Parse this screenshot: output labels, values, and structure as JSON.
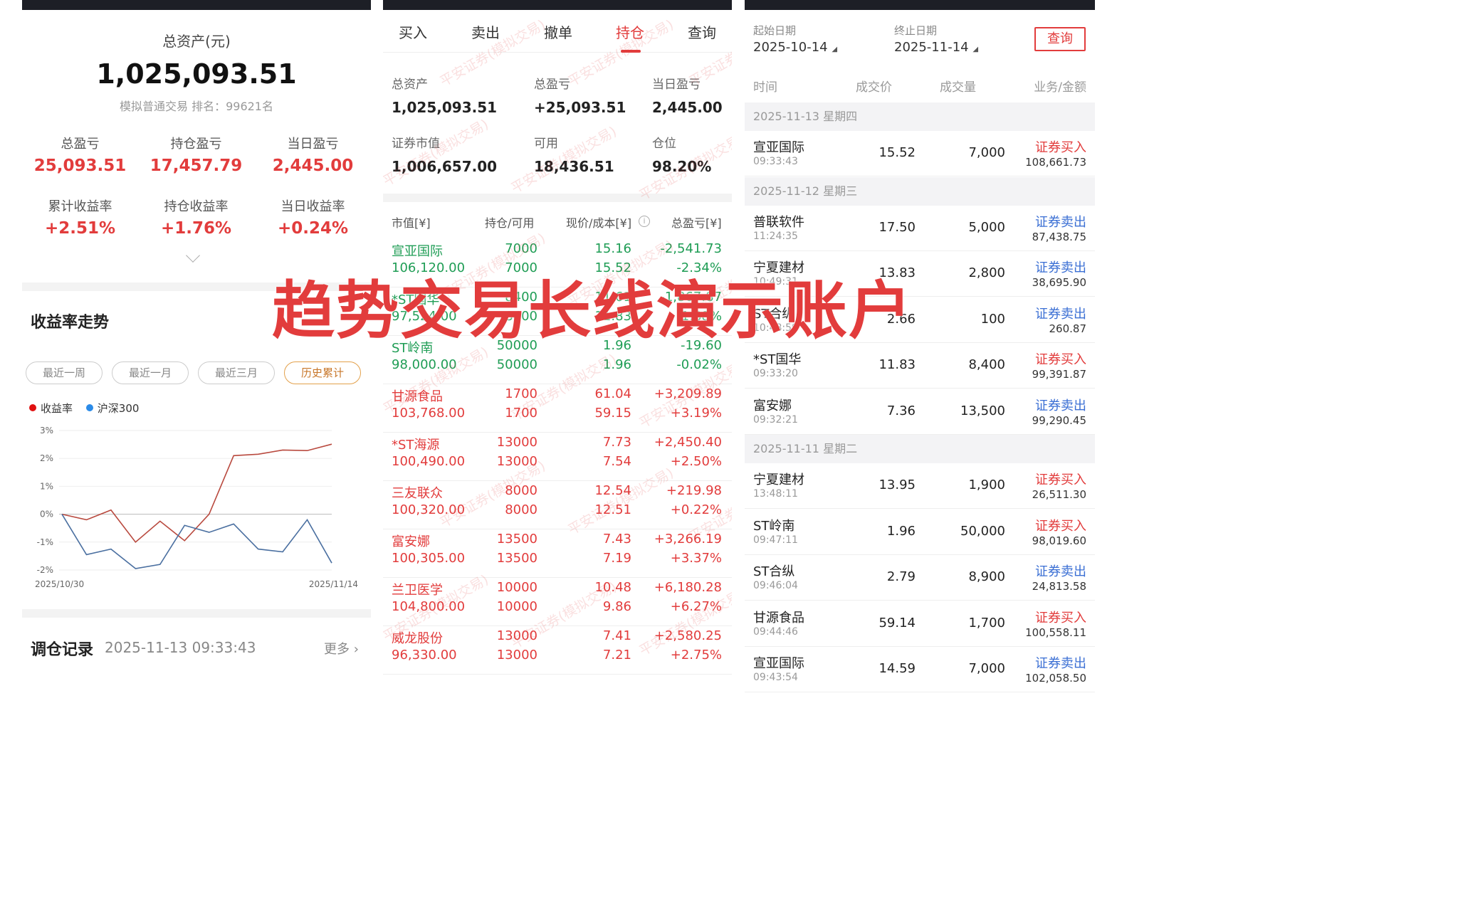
{
  "overview": {
    "total_assets_label": "总资产(元)",
    "total_assets_value": "1,025,093.51",
    "sub_label": "模拟普通交易 排名：99621名",
    "stats": [
      {
        "label": "总盈亏",
        "value": "25,093.51"
      },
      {
        "label": "持仓盈亏",
        "value": "17,457.79"
      },
      {
        "label": "当日盈亏",
        "value": "2,445.00"
      },
      {
        "label": "累计收益率",
        "value": "+2.51%"
      },
      {
        "label": "持仓收益率",
        "value": "+1.76%"
      },
      {
        "label": "当日收益率",
        "value": "+0.24%"
      }
    ],
    "trend_title": "收益率走势",
    "ranges": [
      "最近一周",
      "最近一月",
      "最近三月",
      "历史累计"
    ],
    "active_range": "历史累计",
    "record_title": "调仓记录",
    "record_time": "2025-11-13 09:33:43",
    "record_more": "更多"
  },
  "chart_data": {
    "type": "line",
    "ylim": [
      -2,
      3
    ],
    "yticks": [
      "3%",
      "2%",
      "1%",
      "0%",
      "-1%",
      "-2%"
    ],
    "xlabels": [
      "2025/10/30",
      "2025/11/14"
    ],
    "legend_placement": "top-left",
    "series": [
      {
        "name": "收益率",
        "color": "#b94a3f",
        "values": [
          0,
          -0.2,
          0.15,
          -1.0,
          -0.25,
          -0.95,
          0.0,
          2.1,
          2.15,
          2.3,
          2.28,
          2.51
        ]
      },
      {
        "name": "沪深300",
        "color": "#4a6fa0",
        "values": [
          0,
          -1.45,
          -1.25,
          -1.95,
          -1.8,
          -0.4,
          -0.65,
          -0.35,
          -1.25,
          -1.35,
          -0.2,
          -1.75
        ]
      }
    ]
  },
  "positions": {
    "tabs": [
      "买入",
      "卖出",
      "撤单",
      "持仓",
      "查询"
    ],
    "active_tab": "持仓",
    "summary": [
      {
        "label": "总资产",
        "value": "1,025,093.51",
        "color": "dark"
      },
      {
        "label": "总盈亏",
        "value": "+25,093.51",
        "color": "red"
      },
      {
        "label": "当日盈亏",
        "value": "2,445.00",
        "color": "red"
      },
      {
        "label": "证券市值",
        "value": "1,006,657.00",
        "color": "dark"
      },
      {
        "label": "可用",
        "value": "18,436.51",
        "color": "dark"
      },
      {
        "label": "仓位",
        "value": "98.20%",
        "color": "dark"
      }
    ],
    "headers": [
      "市值[¥]",
      "持仓/可用",
      "现价/成本[¥]",
      "总盈亏[¥]"
    ],
    "info_icon": "info-icon",
    "rows": [
      {
        "name": "宣亚国际",
        "mv": "106,120.00",
        "q1": "7000",
        "q2": "7000",
        "p1": "15.16",
        "p2": "15.52",
        "g1": "-2,541.73",
        "g2": "-2.34%",
        "tone": "green"
      },
      {
        "name": "*ST国华",
        "mv": "97,524.00",
        "q1": "8400",
        "q2": "8400",
        "p1": "11.61",
        "p2": "11.83",
        "g1": "-1,867.87",
        "g2": "-1.88%",
        "tone": "green"
      },
      {
        "name": "ST岭南",
        "mv": "98,000.00",
        "q1": "50000",
        "q2": "50000",
        "p1": "1.96",
        "p2": "1.96",
        "g1": "-19.60",
        "g2": "-0.02%",
        "tone": "green"
      },
      {
        "name": "甘源食品",
        "mv": "103,768.00",
        "q1": "1700",
        "q2": "1700",
        "p1": "61.04",
        "p2": "59.15",
        "g1": "+3,209.89",
        "g2": "+3.19%",
        "tone": "red"
      },
      {
        "name": "*ST海源",
        "mv": "100,490.00",
        "q1": "13000",
        "q2": "13000",
        "p1": "7.73",
        "p2": "7.54",
        "g1": "+2,450.40",
        "g2": "+2.50%",
        "tone": "red"
      },
      {
        "name": "三友联众",
        "mv": "100,320.00",
        "q1": "8000",
        "q2": "8000",
        "p1": "12.54",
        "p2": "12.51",
        "g1": "+219.98",
        "g2": "+0.22%",
        "tone": "red"
      },
      {
        "name": "富安娜",
        "mv": "100,305.00",
        "q1": "13500",
        "q2": "13500",
        "p1": "7.43",
        "p2": "7.19",
        "g1": "+3,266.19",
        "g2": "+3.37%",
        "tone": "red"
      },
      {
        "name": "兰卫医学",
        "mv": "104,800.00",
        "q1": "10000",
        "q2": "10000",
        "p1": "10.48",
        "p2": "9.86",
        "g1": "+6,180.28",
        "g2": "+6.27%",
        "tone": "red"
      },
      {
        "name": "威龙股份",
        "mv": "96,330.00",
        "q1": "13000",
        "q2": "13000",
        "p1": "7.41",
        "p2": "7.21",
        "g1": "+2,580.25",
        "g2": "+2.75%",
        "tone": "red"
      }
    ],
    "watermark": "平安证券(模拟交易)"
  },
  "query": {
    "start_label": "起始日期",
    "start_value": "2025-10-14",
    "end_label": "终止日期",
    "end_value": "2025-11-14",
    "query_button": "查询",
    "headers": [
      "时间",
      "成交价",
      "成交量",
      "业务/金额"
    ],
    "groups": [
      {
        "date": "2025-11-13 星期四",
        "trades": [
          {
            "name": "宣亚国际",
            "time": "09:33:43",
            "price": "15.52",
            "vol": "7,000",
            "type": "证券买入",
            "amount": "108,661.73",
            "side": "buy"
          }
        ]
      },
      {
        "date": "2025-11-12 星期三",
        "trades": [
          {
            "name": "普联软件",
            "time": "11:24:35",
            "price": "17.50",
            "vol": "5,000",
            "type": "证券卖出",
            "amount": "87,438.75",
            "side": "sell"
          },
          {
            "name": "宁夏建材",
            "time": "10:49:31",
            "price": "13.83",
            "vol": "2,800",
            "type": "证券卖出",
            "amount": "38,695.90",
            "side": "sell"
          },
          {
            "name": "ST合纵",
            "time": "10:48:59",
            "price": "2.66",
            "vol": "100",
            "type": "证券卖出",
            "amount": "260.87",
            "side": "sell"
          },
          {
            "name": "*ST国华",
            "time": "09:33:20",
            "price": "11.83",
            "vol": "8,400",
            "type": "证券买入",
            "amount": "99,391.87",
            "side": "buy"
          },
          {
            "name": "富安娜",
            "time": "09:32:21",
            "price": "7.36",
            "vol": "13,500",
            "type": "证券卖出",
            "amount": "99,290.45",
            "side": "sell"
          }
        ]
      },
      {
        "date": "2025-11-11 星期二",
        "trades": [
          {
            "name": "宁夏建材",
            "time": "13:48:11",
            "price": "13.95",
            "vol": "1,900",
            "type": "证券买入",
            "amount": "26,511.30",
            "side": "buy"
          },
          {
            "name": "ST岭南",
            "time": "09:47:11",
            "price": "1.96",
            "vol": "50,000",
            "type": "证券买入",
            "amount": "98,019.60",
            "side": "buy"
          },
          {
            "name": "ST合纵",
            "time": "09:46:04",
            "price": "2.79",
            "vol": "8,900",
            "type": "证券卖出",
            "amount": "24,813.58",
            "side": "sell"
          },
          {
            "name": "甘源食品",
            "time": "09:44:46",
            "price": "59.14",
            "vol": "1,700",
            "type": "证券买入",
            "amount": "100,558.11",
            "side": "buy"
          },
          {
            "name": "宣亚国际",
            "time": "09:43:54",
            "price": "14.59",
            "vol": "7,000",
            "type": "证券卖出",
            "amount": "102,058.50",
            "side": "sell"
          }
        ]
      }
    ]
  },
  "banner": "趋势交易长线演示账户",
  "colors": {
    "red": "#e23c3c",
    "green": "#1f9d55",
    "blue": "#3b6fd4",
    "accent_orange": "#c8772a"
  }
}
